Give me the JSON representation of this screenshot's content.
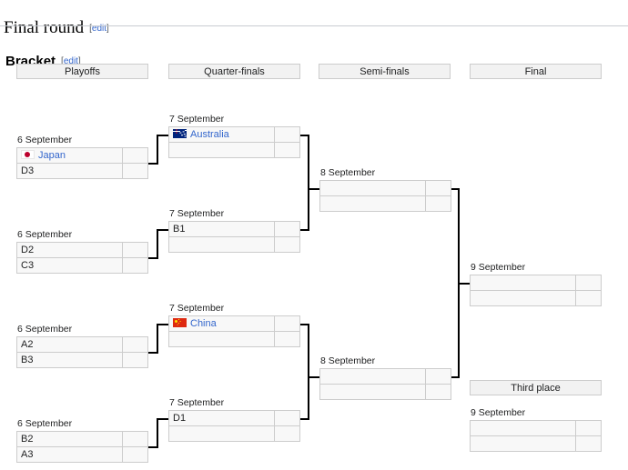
{
  "page": {
    "section_title": "Final round",
    "subsection_title": "Bracket",
    "edit_open": "[",
    "edit_label": "edit",
    "edit_close": "]"
  },
  "rounds": [
    {
      "id": "playoffs",
      "label": "Playoffs"
    },
    {
      "id": "quarter-finals",
      "label": "Quarter-finals"
    },
    {
      "id": "semi-finals",
      "label": "Semi-finals"
    },
    {
      "id": "final",
      "label": "Final"
    }
  ],
  "third_place": {
    "label": "Third place",
    "date": "9 September"
  },
  "matches": {
    "playoff_1": {
      "date": "6 September",
      "team1": {
        "name": "Japan",
        "flag": "japan-flag",
        "is_link": true,
        "score": ""
      },
      "team2": {
        "name": "D3",
        "flag": "",
        "is_link": false,
        "score": ""
      }
    },
    "playoff_2": {
      "date": "6 September",
      "team1": {
        "name": "D2",
        "flag": "",
        "is_link": false,
        "score": ""
      },
      "team2": {
        "name": "C3",
        "flag": "",
        "is_link": false,
        "score": ""
      }
    },
    "playoff_3": {
      "date": "6 September",
      "team1": {
        "name": "A2",
        "flag": "",
        "is_link": false,
        "score": ""
      },
      "team2": {
        "name": "B3",
        "flag": "",
        "is_link": false,
        "score": ""
      }
    },
    "playoff_4": {
      "date": "6 September",
      "team1": {
        "name": "B2",
        "flag": "",
        "is_link": false,
        "score": ""
      },
      "team2": {
        "name": "A3",
        "flag": "",
        "is_link": false,
        "score": ""
      }
    },
    "quarter_1": {
      "date": "7 September",
      "team1": {
        "name": "Australia",
        "flag": "australia-flag",
        "is_link": true,
        "score": ""
      },
      "team2": {
        "name": "",
        "flag": "",
        "is_link": false,
        "score": ""
      }
    },
    "quarter_2": {
      "date": "7 September",
      "team1": {
        "name": "B1",
        "flag": "",
        "is_link": false,
        "score": ""
      },
      "team2": {
        "name": "",
        "flag": "",
        "is_link": false,
        "score": ""
      }
    },
    "quarter_3": {
      "date": "7 September",
      "team1": {
        "name": "China",
        "flag": "china-flag",
        "is_link": true,
        "score": ""
      },
      "team2": {
        "name": "",
        "flag": "",
        "is_link": false,
        "score": ""
      }
    },
    "quarter_4": {
      "date": "7 September",
      "team1": {
        "name": "D1",
        "flag": "",
        "is_link": false,
        "score": ""
      },
      "team2": {
        "name": "",
        "flag": "",
        "is_link": false,
        "score": ""
      }
    },
    "semi_1": {
      "date": "8 September",
      "team1": {
        "name": "",
        "flag": "",
        "is_link": false,
        "score": ""
      },
      "team2": {
        "name": "",
        "flag": "",
        "is_link": false,
        "score": ""
      }
    },
    "semi_2": {
      "date": "8 September",
      "team1": {
        "name": "",
        "flag": "",
        "is_link": false,
        "score": ""
      },
      "team2": {
        "name": "",
        "flag": "",
        "is_link": false,
        "score": ""
      }
    },
    "final": {
      "date": "9 September",
      "team1": {
        "name": "",
        "flag": "",
        "is_link": false,
        "score": ""
      },
      "team2": {
        "name": "",
        "flag": "",
        "is_link": false,
        "score": ""
      }
    },
    "third": {
      "date": "9 September",
      "team1": {
        "name": "",
        "flag": "",
        "is_link": false,
        "score": ""
      },
      "team2": {
        "name": "",
        "flag": "",
        "is_link": false,
        "score": ""
      }
    }
  },
  "colors": {
    "link": "#3366cc",
    "box_border": "#cccccc",
    "box_fill": "#f8f8f8",
    "header_fill": "#f2f2f2",
    "connector": "#000000"
  }
}
